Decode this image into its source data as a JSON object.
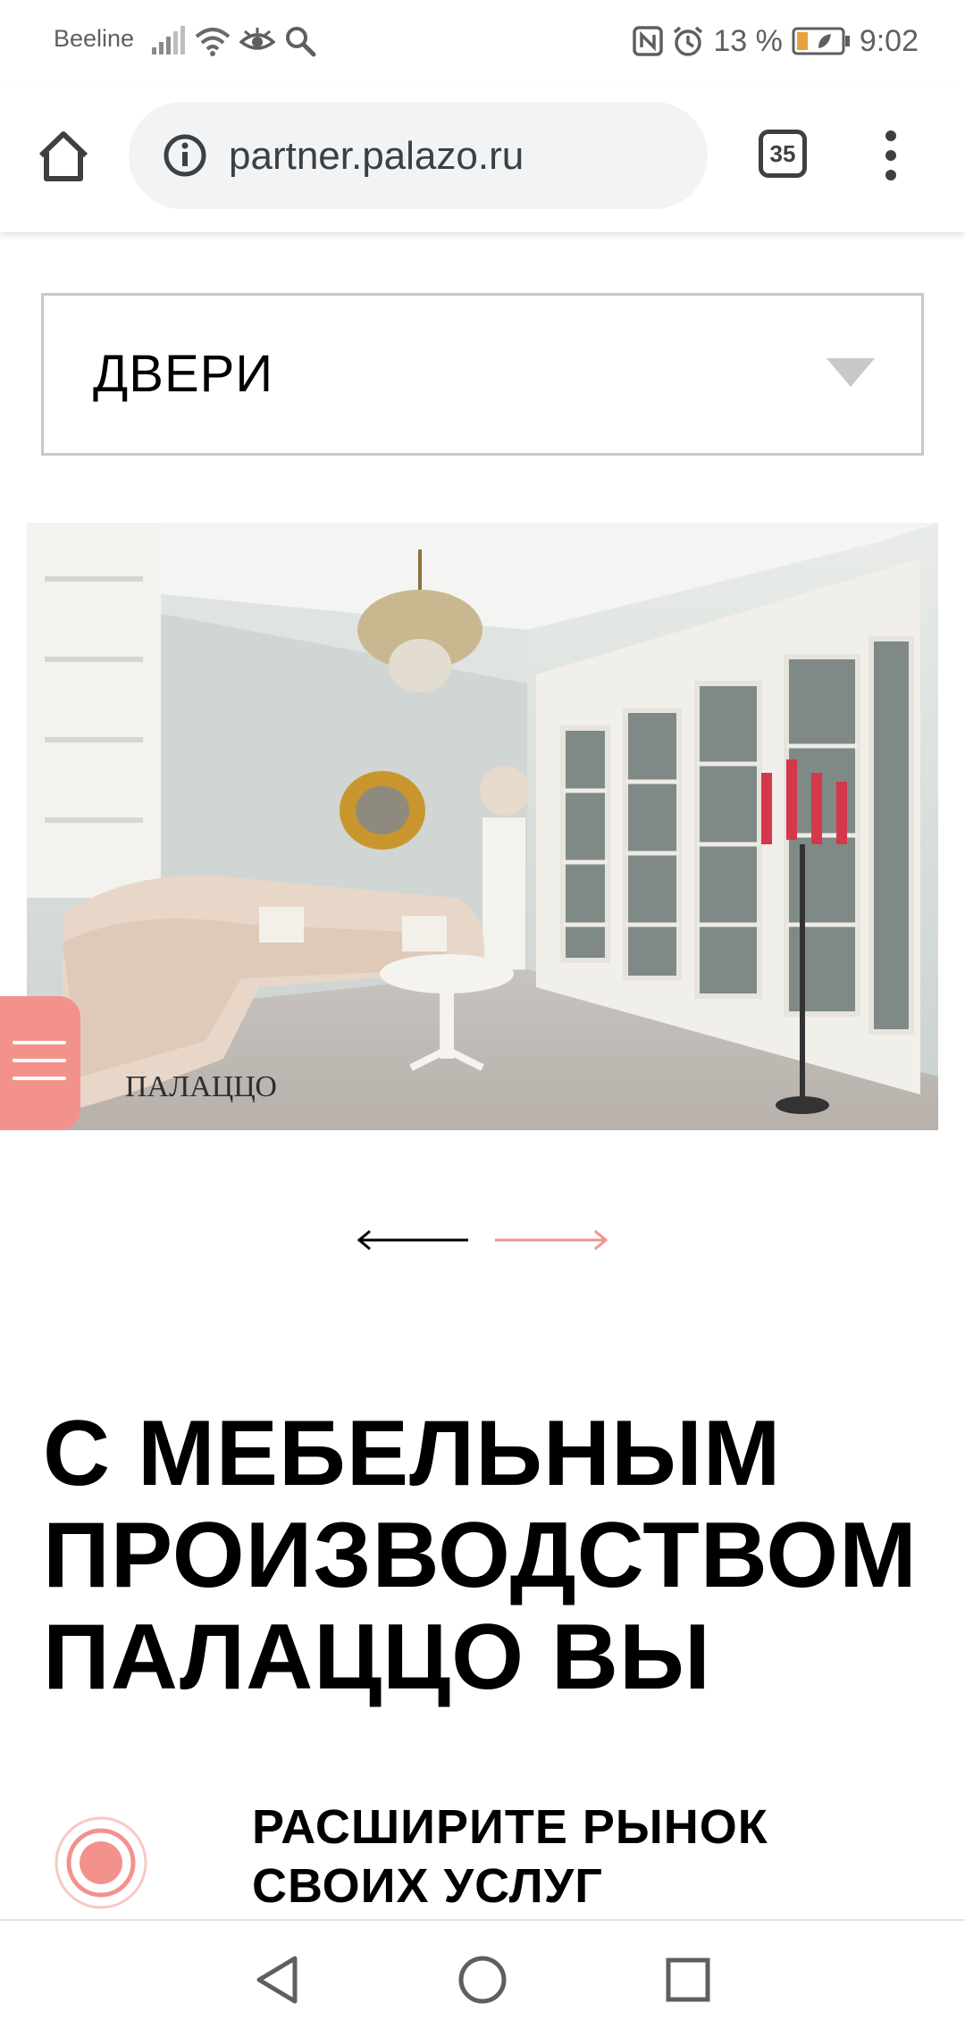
{
  "status_bar": {
    "carrier": "Beeline",
    "battery": "13 %",
    "time": "9:02",
    "icons": [
      "signal-icon",
      "wifi-icon",
      "eye-icon",
      "search-icon",
      "nfc-icon",
      "alarm-icon",
      "battery-icon"
    ]
  },
  "browser": {
    "url": "partner.palazo.ru",
    "tab_count": "35",
    "icons": [
      "home-icon",
      "info-icon",
      "tabs-icon",
      "more-vert-icon"
    ]
  },
  "dropdown": {
    "label": "ДВЕРИ"
  },
  "hero": {
    "watermark": "ПАЛАЦЦО"
  },
  "headline": {
    "lines": [
      "С МЕБЕЛЬНЫМ",
      "ПРОИЗВОДСТВОМ",
      "ПАЛАЦЦО ВЫ"
    ]
  },
  "feature": {
    "lines": [
      "РАСШИРИТЕ РЫНОК",
      "СВОИХ УСЛУГ"
    ]
  },
  "colors": {
    "accent": "#f2928b",
    "dropdown_border": "#c8c8c8",
    "url_bar_bg": "#f1f3f4"
  }
}
